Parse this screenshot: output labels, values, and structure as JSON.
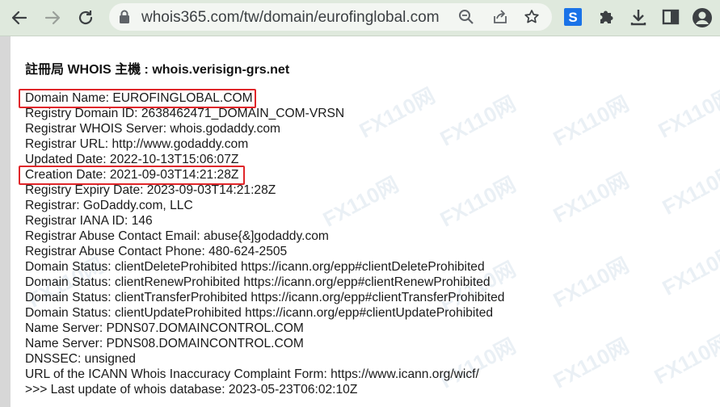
{
  "browser": {
    "url": "whois365.com/tw/domain/eurofinglobal.com",
    "icons": [
      "back-arrow-icon",
      "forward-arrow-icon",
      "reload-icon",
      "lock-icon",
      "zoom-icon",
      "share-icon",
      "star-icon",
      "s-extension-icon",
      "puzzle-icon",
      "download-icon",
      "sidebar-icon",
      "profile-icon"
    ]
  },
  "registry_header": "註冊局 WHOIS 主機 : whois.verisign-grs.net",
  "whois_lines": [
    "Domain Name: EUROFINGLOBAL.COM",
    "Registry Domain ID: 2638462471_DOMAIN_COM-VRSN",
    "Registrar WHOIS Server: whois.godaddy.com",
    "Registrar URL: http://www.godaddy.com",
    "Updated Date: 2022-10-13T15:06:07Z",
    "Creation Date: 2021-09-03T14:21:28Z",
    "Registry Expiry Date: 2023-09-03T14:21:28Z",
    "Registrar: GoDaddy.com, LLC",
    "Registrar IANA ID: 146",
    "Registrar Abuse Contact Email: abuse{&]godaddy.com",
    "Registrar Abuse Contact Phone: 480-624-2505",
    "Domain Status: clientDeleteProhibited https://icann.org/epp#clientDeleteProhibited",
    "Domain Status: clientRenewProhibited https://icann.org/epp#clientRenewProhibited",
    "Domain Status: clientTransferProhibited https://icann.org/epp#clientTransferProhibited",
    "Domain Status: clientUpdateProhibited https://icann.org/epp#clientUpdateProhibited",
    "Name Server: PDNS07.DOMAINCONTROL.COM",
    "Name Server: PDNS08.DOMAINCONTROL.COM",
    "DNSSEC: unsigned",
    "URL of the ICANN Whois Inaccuracy Complaint Form: https://www.icann.org/wicf/",
    ">>> Last update of whois database: 2023-05-23T06:02:10Z"
  ],
  "watermark": "FX110网",
  "colors": {
    "toolbar": "#dfe9dd",
    "highlight": "#e0262a",
    "ext_blue": "#1a73e8"
  }
}
